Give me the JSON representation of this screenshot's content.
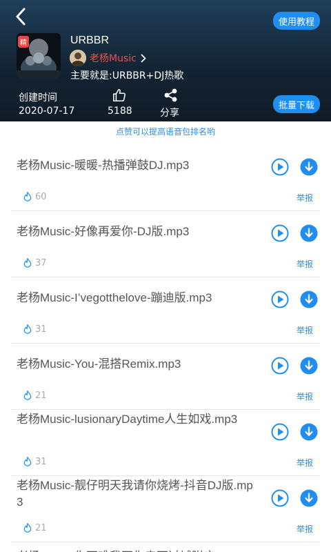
{
  "header": {
    "tutorial_label": "使用教程",
    "batch_download_label": "批量下载",
    "cover_badge": "精",
    "title": "URBBR",
    "author": "老杨Music",
    "description": "主要就是:URBBR+DJ热歌",
    "created_label": "创建时间",
    "created_value": "2020-07-17",
    "like_count": "5188",
    "share_label": "分享"
  },
  "notice": "点赞可以提高语音包排名哟",
  "report_label": "举报",
  "items": [
    {
      "name": "老杨Music-暖暖-热播弹鼓DJ.mp3",
      "heat": "60"
    },
    {
      "name": "老杨Music-好像再爱你-DJ版.mp3",
      "heat": "37"
    },
    {
      "name": "老杨Music-I’vegotthelove-蹦迪版.mp3",
      "heat": "31"
    },
    {
      "name": "老杨Music-You-混搭Remix.mp3",
      "heat": "21"
    },
    {
      "name": "老杨Music-lusionaryDaytime人生如戏.mp3",
      "heat": "31"
    },
    {
      "name": "老杨Music-靓仔明天我请你烧烤-抖音DJ版.mp3",
      "heat": "21"
    }
  ],
  "partial_item": "老杨Music-你不难我不你走不过城附庄",
  "colors": {
    "accent_blue": "#1e8ff0",
    "author_red": "#e85050",
    "header_dark": "#142434"
  }
}
